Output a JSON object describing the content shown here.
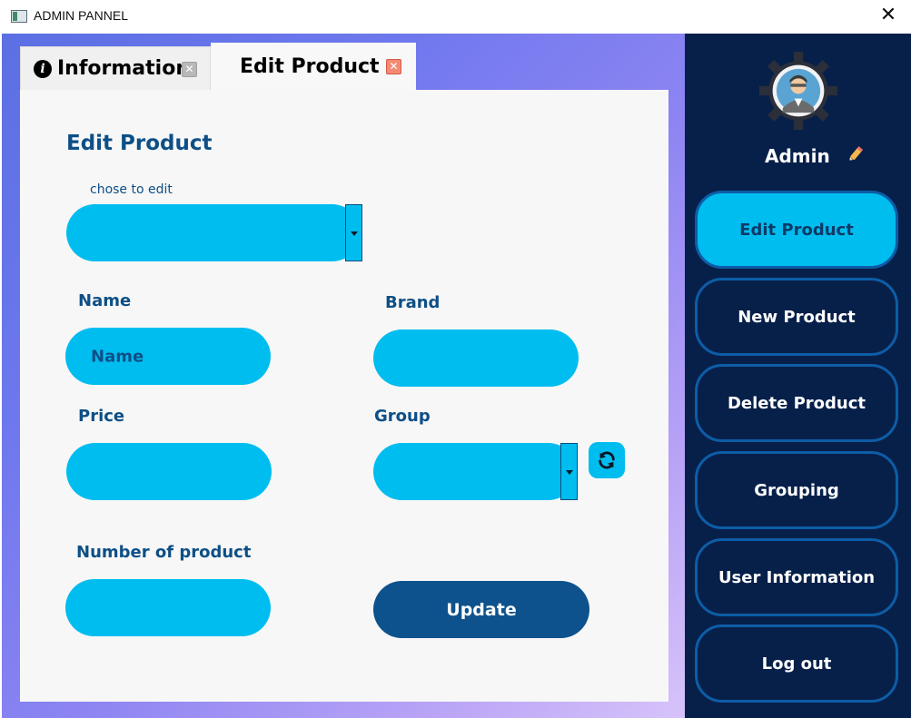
{
  "window": {
    "title": "ADMIN PANNEL",
    "close_glyph": "✕"
  },
  "tabs": [
    {
      "label": "Information",
      "icon": "info-icon",
      "close_glyph": "✕"
    },
    {
      "label": "Edit Product",
      "close_glyph": "✕",
      "active": true
    }
  ],
  "form": {
    "heading": "Edit Product",
    "chooser_label": "chose to edit",
    "chooser_value": "",
    "name_label": "Name",
    "name_placeholder": "Name",
    "brand_label": "Brand",
    "brand_value": "",
    "price_label": "Price",
    "price_value": "",
    "group_label": "Group",
    "group_value": "",
    "count_label": "Number of product",
    "count_value": "",
    "update_label": "Update"
  },
  "sidebar": {
    "user_name": "Admin",
    "items": [
      {
        "label": "Edit Product",
        "active": true
      },
      {
        "label": "New Product"
      },
      {
        "label": "Delete Product"
      },
      {
        "label": "Grouping"
      },
      {
        "label": "User Information"
      },
      {
        "label": "Log out"
      }
    ]
  },
  "colors": {
    "field_fill": "#00bdf0",
    "navy_text": "#0d4f86",
    "sidebar_bg": "#07204a",
    "sidebar_border": "#0d5da6",
    "update_button": "#0d528d"
  }
}
